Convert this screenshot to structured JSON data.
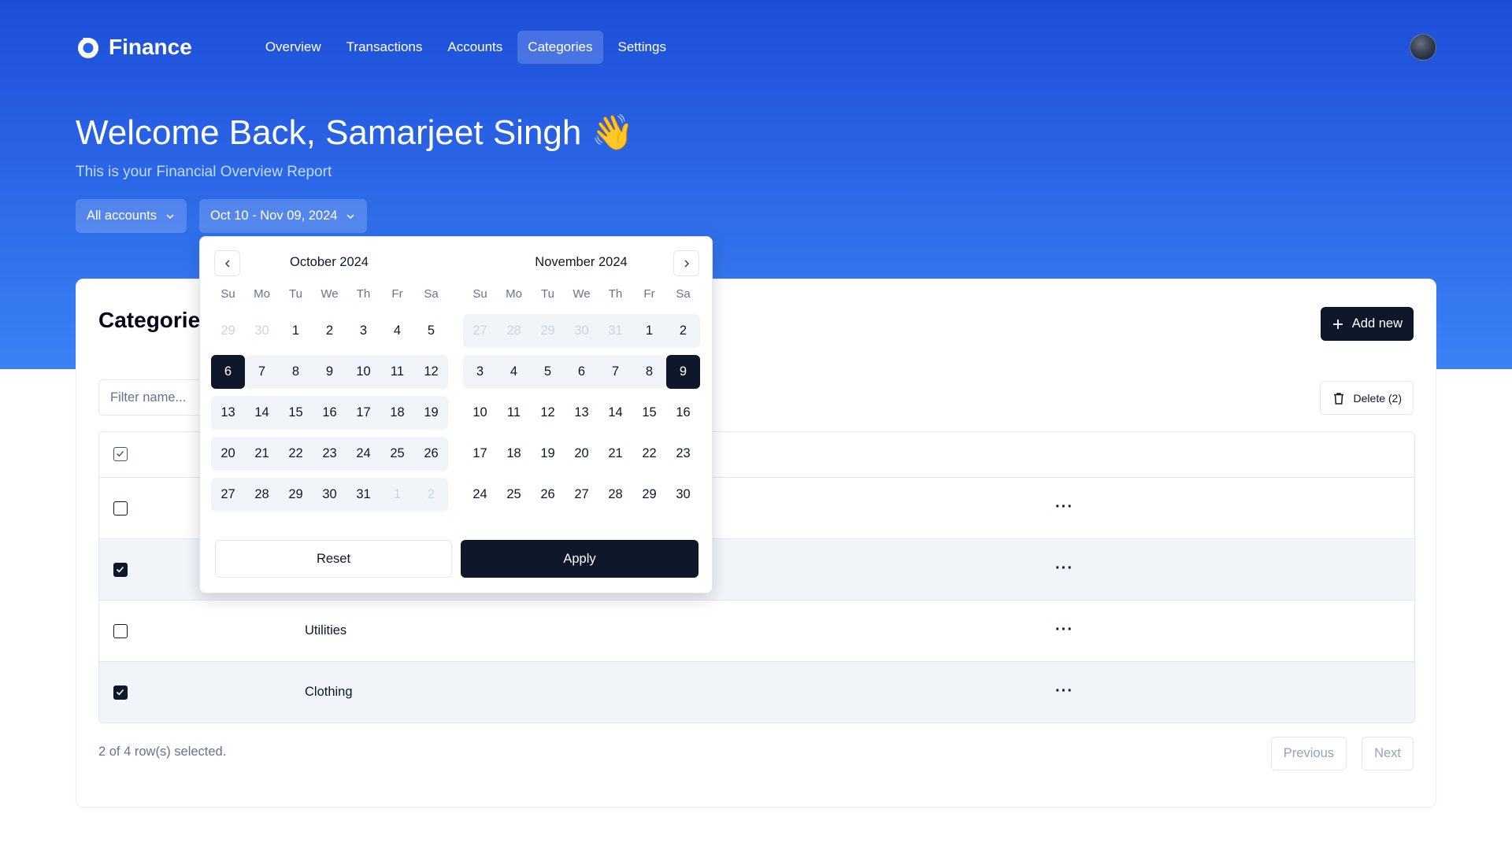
{
  "brand": {
    "name": "Finance"
  },
  "nav": [
    "Overview",
    "Transactions",
    "Accounts",
    "Categories",
    "Settings"
  ],
  "nav_active": "Categories",
  "welcome": {
    "title": "Welcome Back, Samarjeet Singh 👋",
    "subtitle": "This is your Financial Overview Report"
  },
  "filters": {
    "account": "All accounts",
    "date_range": "Oct 10 - Nov 09, 2024"
  },
  "card": {
    "title": "Categories",
    "add_label": "Add new",
    "filter_placeholder": "Filter name...",
    "delete_label": "Delete (2)"
  },
  "table": {
    "rows": [
      {
        "name": "",
        "checked": false
      },
      {
        "name": "",
        "checked": true
      },
      {
        "name": "Utilities",
        "checked": false
      },
      {
        "name": "Clothing",
        "checked": true
      }
    ],
    "row_menu": "···"
  },
  "footer": {
    "selection": "2 of 4 row(s) selected.",
    "previous": "Previous",
    "next": "Next"
  },
  "datepicker": {
    "weekdays": [
      "Su",
      "Mo",
      "Tu",
      "We",
      "Th",
      "Fr",
      "Sa"
    ],
    "months": [
      {
        "title": "October 2024",
        "weeks": [
          [
            "29",
            "30",
            "1",
            "2",
            "3",
            "4",
            "5"
          ],
          [
            "6",
            "7",
            "8",
            "9",
            "10",
            "11",
            "12"
          ],
          [
            "13",
            "14",
            "15",
            "16",
            "17",
            "18",
            "19"
          ],
          [
            "20",
            "21",
            "22",
            "23",
            "24",
            "25",
            "26"
          ],
          [
            "27",
            "28",
            "29",
            "30",
            "31",
            "1",
            "2"
          ]
        ],
        "outside": [
          [
            0,
            0
          ],
          [
            0,
            1
          ],
          [
            4,
            5
          ],
          [
            4,
            6
          ]
        ]
      },
      {
        "title": "November 2024",
        "weeks": [
          [
            "27",
            "28",
            "29",
            "30",
            "31",
            "1",
            "2"
          ],
          [
            "3",
            "4",
            "5",
            "6",
            "7",
            "8",
            "9"
          ],
          [
            "10",
            "11",
            "12",
            "13",
            "14",
            "15",
            "16"
          ],
          [
            "17",
            "18",
            "19",
            "20",
            "21",
            "22",
            "23"
          ],
          [
            "24",
            "25",
            "26",
            "27",
            "28",
            "29",
            "30"
          ]
        ],
        "outside": [
          [
            0,
            0
          ],
          [
            0,
            1
          ],
          [
            0,
            2
          ],
          [
            0,
            3
          ],
          [
            0,
            4
          ]
        ]
      }
    ],
    "range_start": "October 6, 2024",
    "range_end": "November 9, 2024",
    "reset_label": "Reset",
    "apply_label": "Apply"
  }
}
